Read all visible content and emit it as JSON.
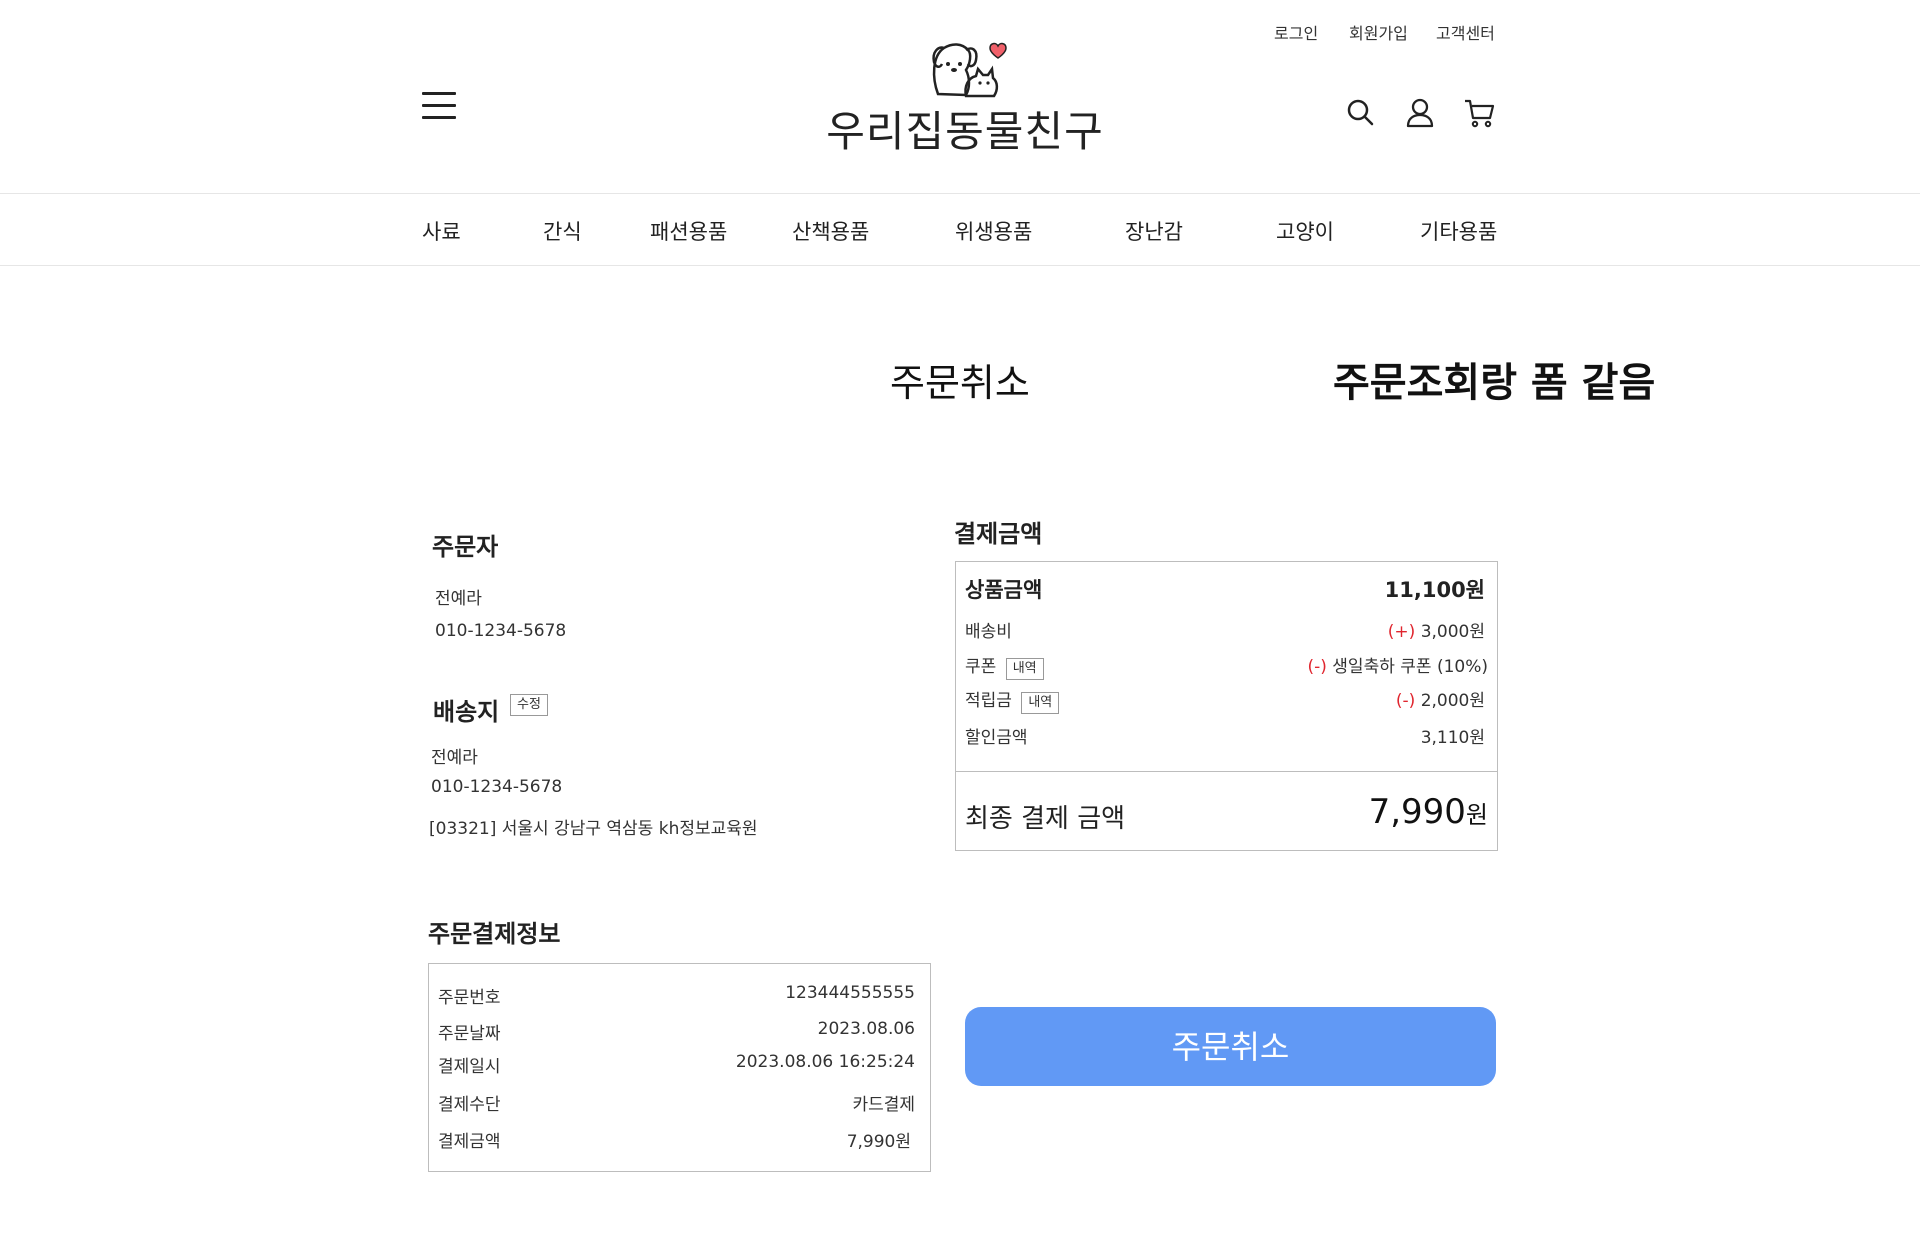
{
  "header": {
    "top_links": [
      "로그인",
      "회원가입",
      "고객센터"
    ],
    "logo_text": "우리집동물친구",
    "icons": [
      "menu-icon",
      "search-icon",
      "user-icon",
      "cart-icon"
    ]
  },
  "nav": {
    "categories": [
      "사료",
      "간식",
      "패션용품",
      "산책용품",
      "위생용품",
      "장난감",
      "고양이",
      "기타용품"
    ]
  },
  "page": {
    "title": "주문취소",
    "note": "주문조회랑 폼 같음"
  },
  "orderer": {
    "title": "주문자",
    "name": "전예라",
    "phone": "010-1234-5678"
  },
  "shipping": {
    "title": "배송지",
    "edit_label": "수정",
    "name": "전예라",
    "phone": "010-1234-5678",
    "address": "[03321] 서울시 강남구 역삼동 kh정보교육원"
  },
  "payment_info": {
    "title": "주문결제정보",
    "rows": [
      {
        "label": "주문번호",
        "value": "123444555555"
      },
      {
        "label": "주문날짜",
        "value": "2023.08.06"
      },
      {
        "label": "결제일시",
        "value": "2023.08.06 16:25:24"
      },
      {
        "label": "결제수단",
        "value": "카드결제"
      },
      {
        "label": "결제금액",
        "value": "7,990원"
      }
    ]
  },
  "amount": {
    "title": "결제금액",
    "product_label": "상품금액",
    "product_value": "11,100원",
    "shipping_label": "배송비",
    "shipping_sign": "(+)",
    "shipping_value": "3,000원",
    "coupon_label": "쿠폰",
    "coupon_detail": "내역",
    "coupon_sign": "(-)",
    "coupon_value": "생일축하 쿠폰 (10%)",
    "points_label": "적립금",
    "points_detail": "내역",
    "points_sign": "(-)",
    "points_value": "2,000원",
    "discount_label": "할인금액",
    "discount_value": "3,110원",
    "final_label": "최종 결제 금액",
    "final_number": "7,990",
    "final_unit": "원"
  },
  "actions": {
    "cancel_label": "주문취소"
  },
  "colors": {
    "button": "#6199f5",
    "sign": "#e0262f",
    "heart": "#f0606a"
  }
}
